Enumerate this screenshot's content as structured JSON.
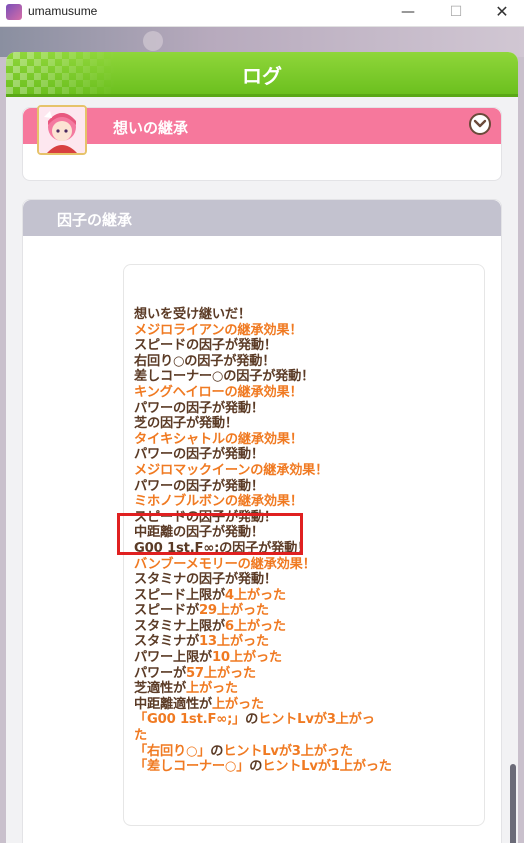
{
  "window": {
    "title": "umamusume",
    "minimize": "—",
    "maximize": "☐",
    "close": "✕"
  },
  "dialog": {
    "title": "ログ",
    "section1": {
      "title": "想いの継承"
    },
    "section2": {
      "title": "因子の継承"
    },
    "log": [
      {
        "text": "想いを受け継いだ！",
        "color": "dark"
      },
      {
        "text": "メジロライアンの継承効果！",
        "color": "orange"
      },
      {
        "text": "スピードの因子が発動！",
        "color": "dark"
      },
      {
        "text": "右回り○の因子が発動！",
        "color": "dark"
      },
      {
        "text": "差しコーナー○の因子が発動！",
        "color": "dark"
      },
      {
        "text": "キングヘイローの継承効果！",
        "color": "orange"
      },
      {
        "text": "パワーの因子が発動！",
        "color": "dark"
      },
      {
        "text": "芝の因子が発動！",
        "color": "dark"
      },
      {
        "text": "タイキシャトルの継承効果！",
        "color": "orange"
      },
      {
        "text": "パワーの因子が発動！",
        "color": "dark"
      },
      {
        "text": "メジロマックイーンの継承効果！",
        "color": "orange"
      },
      {
        "text": "パワーの因子が発動！",
        "color": "dark"
      },
      {
        "text": "ミホノブルボンの継承効果！",
        "color": "orange"
      },
      {
        "text": "スピードの因子が発動！",
        "color": "dark"
      },
      {
        "text": "中距離の因子が発動！",
        "color": "dark"
      },
      {
        "text": "G00 1st.F∞;の因子が発動！",
        "color": "dark"
      },
      {
        "text": "バンブーメモリーの継承効果！",
        "color": "orange"
      },
      {
        "text": "スタミナの因子が発動！",
        "color": "dark"
      }
    ],
    "gains": [
      {
        "prefix": "スピード上限が",
        "value": "4上がった"
      },
      {
        "prefix": "スピードが",
        "value": "29上がった"
      },
      {
        "prefix": "スタミナ上限が",
        "value": "6上がった"
      },
      {
        "prefix": "スタミナが",
        "value": "13上がった"
      },
      {
        "prefix": "パワー上限が",
        "value": "10上がった"
      },
      {
        "prefix": "パワーが",
        "value": "57上がった"
      },
      {
        "prefix": "芝適性が",
        "value": "上がった"
      },
      {
        "prefix": "中距離適性が",
        "value": "上がった"
      }
    ],
    "hints": [
      {
        "skill": "「G00 1st.F∞;」",
        "mid": "の",
        "rest": "ヒントLvが3上がっ",
        "wrap": "た"
      },
      {
        "skill": "「右回り○」",
        "mid": "の",
        "rest": "ヒントLvが3上がった",
        "wrap": ""
      },
      {
        "skill": "「差しコーナー○」",
        "mid": "の",
        "rest": "ヒントLvが1上がった",
        "wrap": ""
      }
    ]
  },
  "colors": {
    "header_green": "#7ccb2c",
    "pink": "#f6789c",
    "gray_header": "#c3c2cf",
    "text_dark": "#5b3b26",
    "text_orange": "#f07a22",
    "highlight_red": "#e02020"
  }
}
